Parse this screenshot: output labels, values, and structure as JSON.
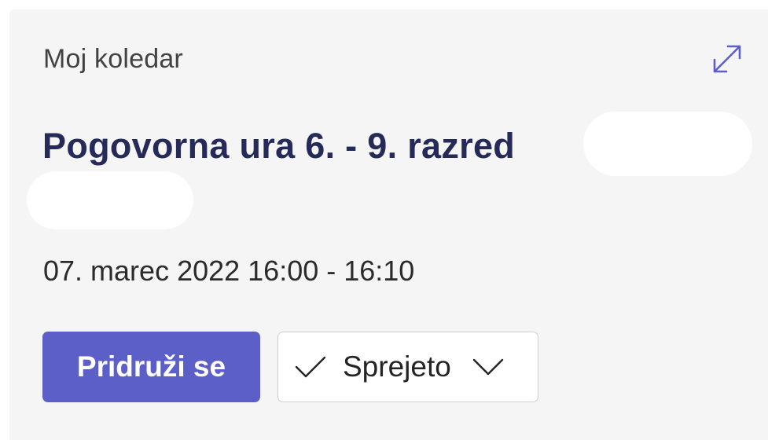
{
  "card": {
    "header_label": "Moj koledar",
    "title": "Pogovorna ura 6. - 9. razred",
    "datetime": "07. marec 2022 16:00 - 16:10",
    "join_label": "Pridruži se",
    "rsvp_label": "Sprejeto"
  },
  "icons": {
    "expand": "expand-arrows-icon",
    "check": "checkmark-icon",
    "chevron": "chevron-down-icon"
  },
  "colors": {
    "accent": "#5b5fc7",
    "title": "#252a59",
    "background": "#f5f5f5"
  }
}
